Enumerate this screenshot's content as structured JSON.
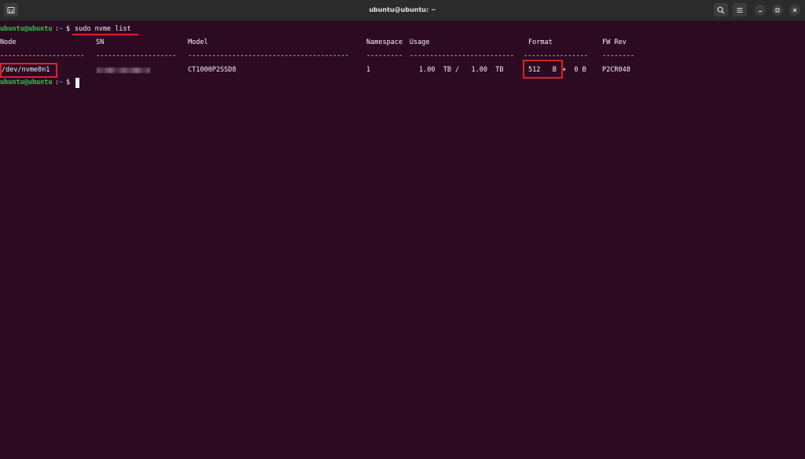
{
  "window": {
    "title": "ubuntu@ubuntu: ~"
  },
  "prompt": {
    "user": "ubuntu@ubuntu",
    "path": "~",
    "sign": "$"
  },
  "command": "sudo nvme list",
  "table": {
    "headers": {
      "node": "Node",
      "sn": "SN",
      "model": "Model",
      "namespace": "Namespace",
      "usage": "Usage",
      "format": "Format",
      "fw_rev": "FW Rev"
    },
    "separators": {
      "node": "---------------------",
      "sn": "--------------------",
      "model": "----------------------------------------",
      "namespace": "---------",
      "usage": "--------------------------",
      "format": "----------------",
      "fw_rev": "--------"
    },
    "row": {
      "node": "/dev/nvme0n1",
      "namespace": "1",
      "model": "CT1000P2SSD8",
      "usage": "1.00  TB /   1.00  TB",
      "format_lba": "512   B",
      "format_rest": "+  0 B",
      "fw_rev": "P2CR048"
    }
  },
  "icons": {
    "new_tab": "new-tab-icon",
    "search": "search-icon",
    "menu": "hamburger-menu-icon",
    "minimize": "minimize-icon",
    "maximize": "maximize-icon",
    "close": "close-icon"
  },
  "colors": {
    "terminal_bg": "#2c0a22",
    "prompt_user": "#33c24b",
    "prompt_path": "#4d8dd6",
    "annotation": "#e0202a"
  }
}
